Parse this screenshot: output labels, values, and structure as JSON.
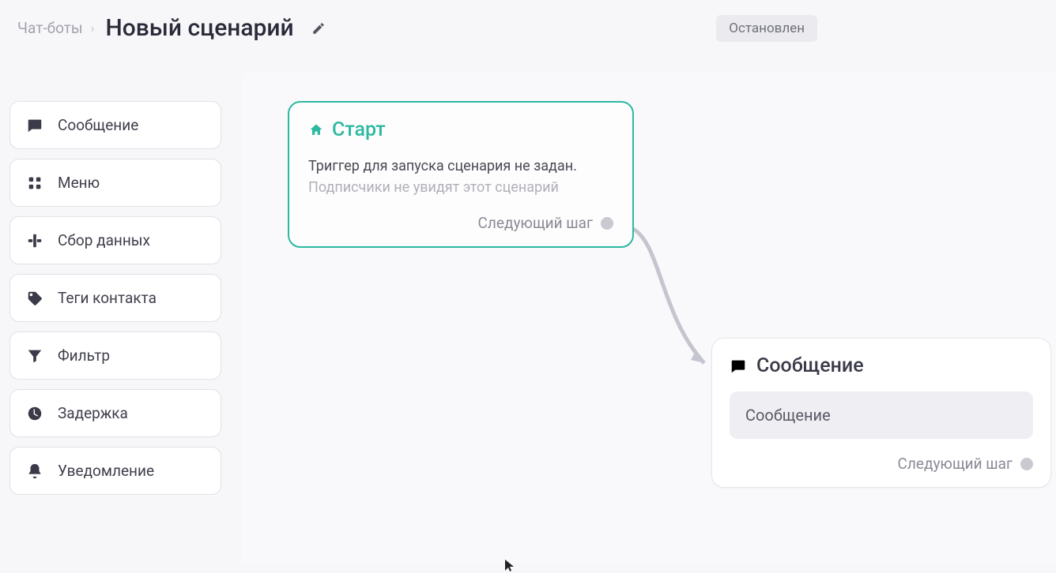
{
  "header": {
    "breadcrumb": "Чат-боты",
    "title": "Новый сценарий",
    "status": "Остановлен"
  },
  "sidebar": {
    "items": [
      {
        "label": "Сообщение",
        "icon": "message-icon"
      },
      {
        "label": "Меню",
        "icon": "grid-icon"
      },
      {
        "label": "Сбор данных",
        "icon": "data-icon"
      },
      {
        "label": "Теги контакта",
        "icon": "tag-icon"
      },
      {
        "label": "Фильтр",
        "icon": "funnel-icon"
      },
      {
        "label": "Задержка",
        "icon": "clock-icon"
      },
      {
        "label": "Уведомление",
        "icon": "bell-icon"
      }
    ]
  },
  "nodes": {
    "start": {
      "title": "Старт",
      "text": "Триггер для запуска сценария не задан.",
      "subtext": "Подписчики не увидят этот сценарий",
      "next_label": "Следующий шаг"
    },
    "message": {
      "title": "Сообщение",
      "body": "Сообщение",
      "next_label": "Следующий шаг"
    }
  }
}
